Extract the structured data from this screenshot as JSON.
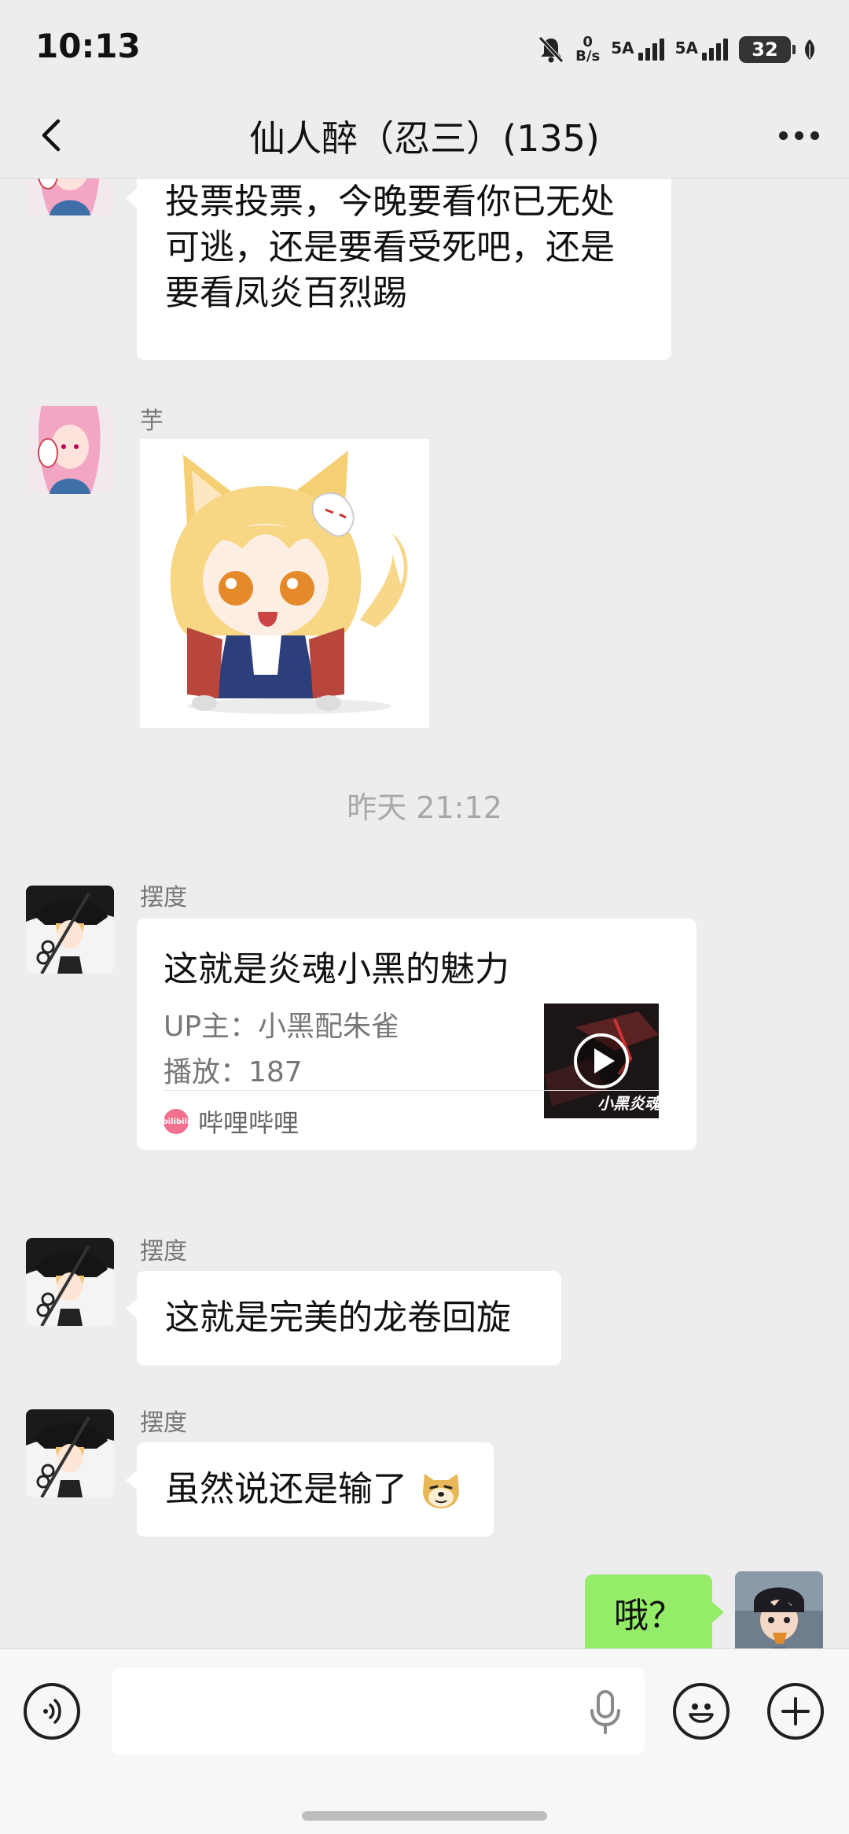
{
  "status_bar": {
    "time": "10:13",
    "net_speed_value": "0",
    "net_speed_unit": "B/s",
    "signal1_label": "5A",
    "signal2_label": "5A",
    "battery": "32"
  },
  "header": {
    "title": "仙人醉（忍三）(135)"
  },
  "messages": [
    {
      "type": "text",
      "sender": "",
      "lines": [
        "投票投票，今晚要看你已无处",
        "可逃，还是要看受死吧，还是",
        "要看凤炎百烈踢"
      ]
    },
    {
      "type": "sticker",
      "sender": "芋",
      "icon": "fox-girl-sticker"
    },
    {
      "type": "timestamp",
      "text": "昨天 21:12"
    },
    {
      "type": "link_card",
      "sender": "摆度",
      "title": "这就是炎魂小黑的魅力",
      "up_label": "UP主：小黑配朱雀",
      "plays_label": "播放：187",
      "source": "哔哩哔哩",
      "source_icon_text": "bilibili",
      "thumb_caption": "小黑炎魂"
    },
    {
      "type": "text",
      "sender": "摆度",
      "text": "这就是完美的龙卷回旋"
    },
    {
      "type": "text",
      "sender": "摆度",
      "text": "虽然说还是输了",
      "emoji": "doge-emoji"
    },
    {
      "type": "text",
      "sender": "me",
      "text": "哦？"
    }
  ],
  "input_bar": {
    "placeholder": "",
    "icons": [
      "voice-toggle-icon",
      "microphone-icon",
      "emoji-icon",
      "plus-icon"
    ]
  },
  "colors": {
    "background": "#ededed",
    "my_bubble": "#95ec69",
    "their_bubble": "#ffffff",
    "bilibili_pink": "#f0708e"
  }
}
